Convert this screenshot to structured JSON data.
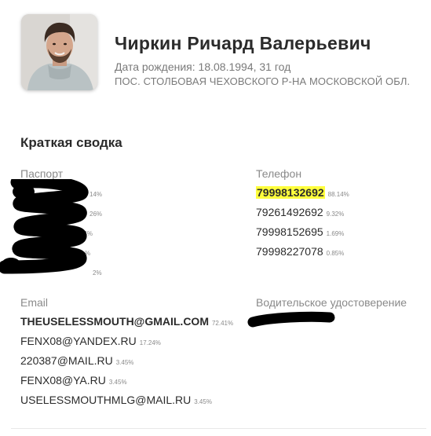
{
  "profile": {
    "name": "Чиркин Ричард Валерьевич",
    "birth": "Дата рождения: 18.08.1994, 31 год",
    "address": "ПОС. СТОЛБОВАЯ ЧЕХОВСКОГО Р-НА МОСКОВСКОЙ ОБЛ."
  },
  "summary": {
    "title": "Краткая сводка"
  },
  "passport": {
    "label": "Паспорт",
    "rows": [
      {
        "pct": "14%"
      },
      {
        "pct": "26%"
      },
      {
        "pct": "24%"
      },
      {
        "pct": "%"
      },
      {
        "pct": "2%"
      }
    ]
  },
  "phone": {
    "label": "Телефон",
    "rows": [
      {
        "value": "79998132692",
        "pct": "88.14%"
      },
      {
        "value": "79261492692",
        "pct": "9.32%"
      },
      {
        "value": "79998152695",
        "pct": "1.69%"
      },
      {
        "value": "79998227078",
        "pct": "0.85%"
      }
    ]
  },
  "email": {
    "label": "Email",
    "rows": [
      {
        "value": "THEUSELESSMOUTH@GMAIL.COM",
        "pct": "72.41%"
      },
      {
        "value": "FENX08@YANDEX.RU",
        "pct": "17.24%"
      },
      {
        "value": "220387@MAIL.RU",
        "pct": "3.45%"
      },
      {
        "value": "FENX08@YA.RU",
        "pct": "3.45%"
      },
      {
        "value": "USELESSMOUTHMLG@MAIL.RU",
        "pct": "3.45%"
      }
    ]
  },
  "license": {
    "label": "Водительское удостоверение"
  },
  "colors": {
    "highlight": "#ffff3d",
    "redaction": "#000000",
    "muted": "#8a8a8a",
    "text": "#2b2b2b"
  }
}
